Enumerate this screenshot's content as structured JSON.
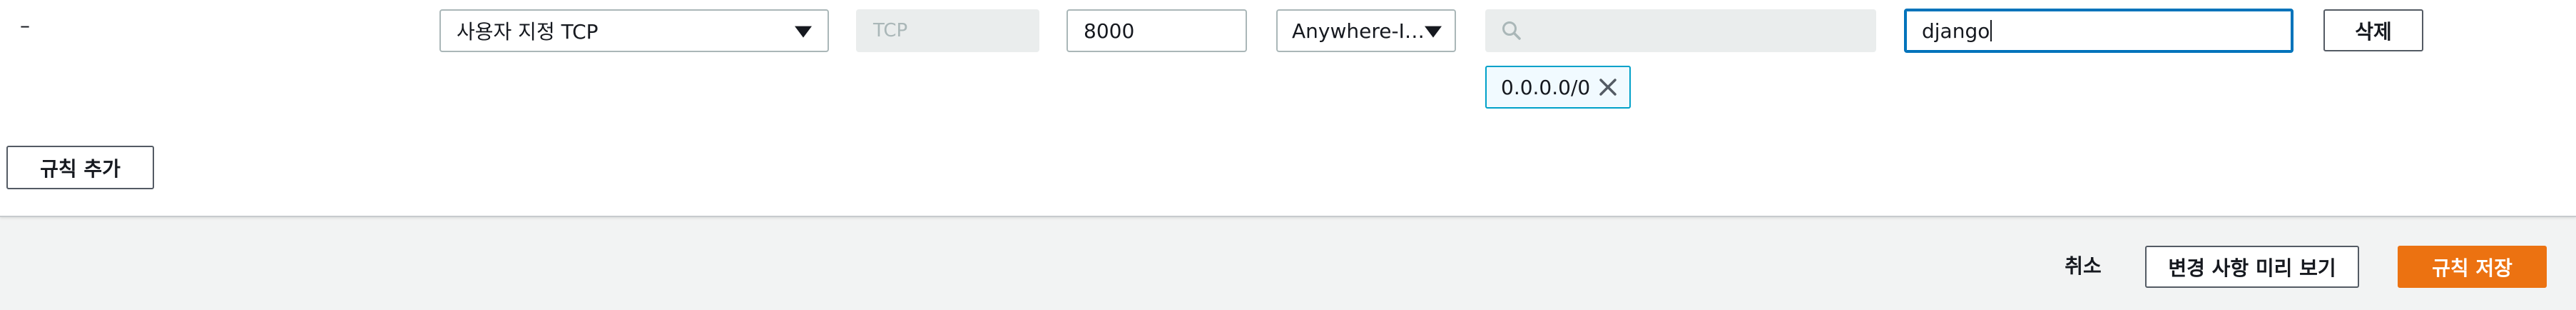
{
  "rule": {
    "dash_text": "–",
    "type_select": {
      "value": "사용자 지정 TCP",
      "icon": "triangle-down"
    },
    "protocol": {
      "value": "TCP"
    },
    "port_range": {
      "value": "8000"
    },
    "source_select": {
      "value": "Anywhere-I…",
      "icon": "triangle-down"
    },
    "cidr_search": {
      "placeholder": "",
      "icon": "search"
    },
    "cidr_token": {
      "value": "0.0.0.0/0",
      "icon": "close"
    },
    "description": {
      "value": "django"
    },
    "delete_label": "삭제"
  },
  "add_rule_label": "규칙 추가",
  "footer": {
    "cancel_label": "취소",
    "preview_label": "변경 사항 미리 보기",
    "save_label": "규칙 저장"
  },
  "colors": {
    "primary": "#ec7211",
    "focus": "#0073bb",
    "token_border": "#00a1c9",
    "footer_bg": "#f2f3f3"
  }
}
